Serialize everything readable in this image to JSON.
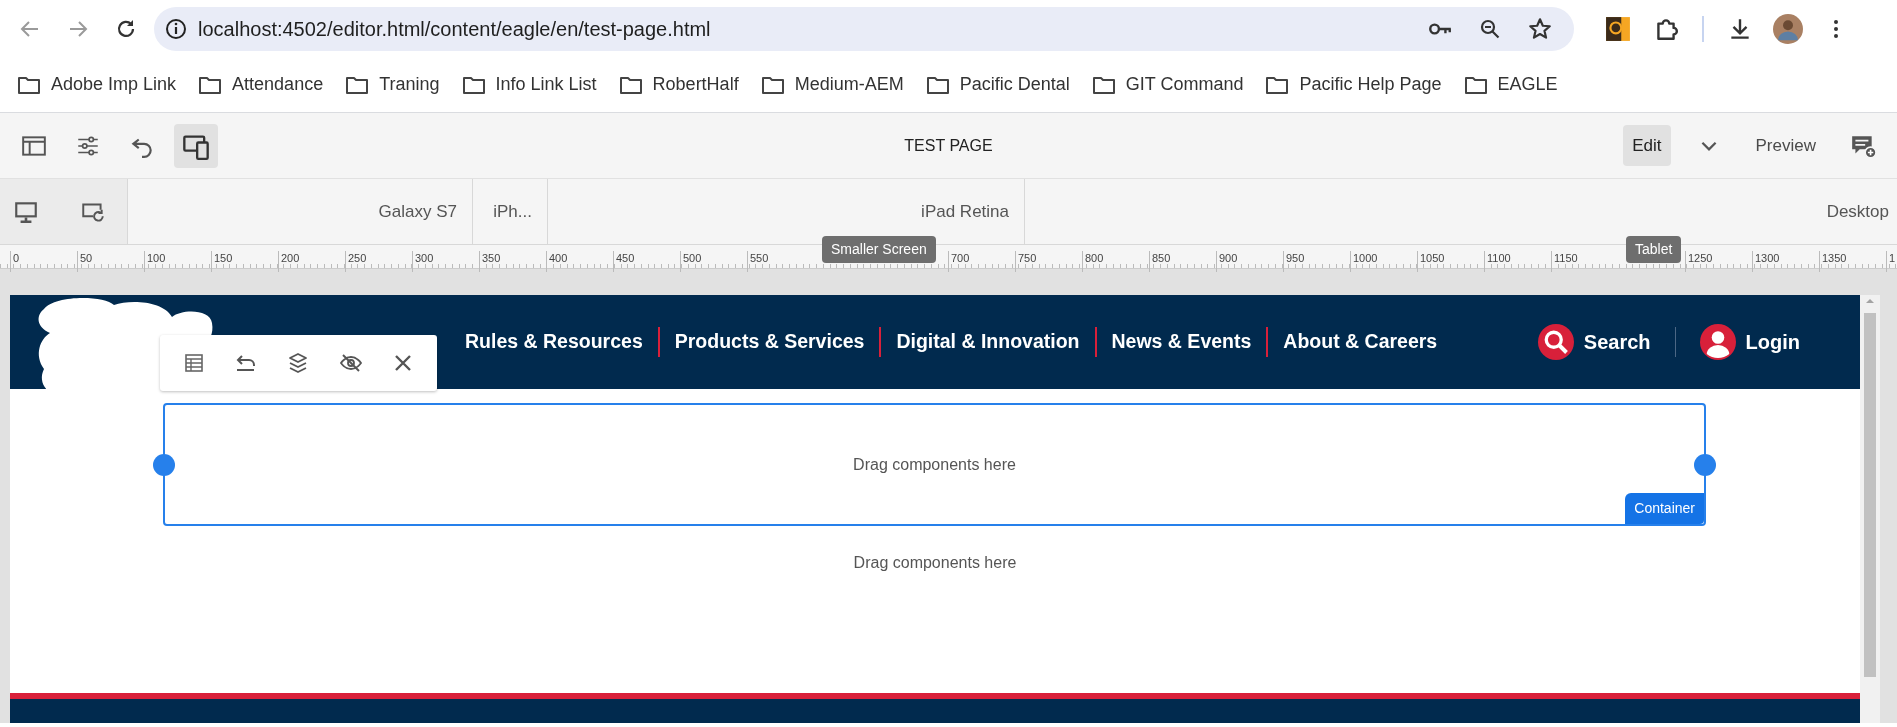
{
  "browser": {
    "url": "localhost:4502/editor.html/content/eagle/en/test-page.html",
    "bookmarks": [
      "Adobe Imp Link",
      "Attendance",
      "Traning",
      "Info Link List",
      "RobertHalf",
      "Medium-AEM",
      "Pacific Dental",
      "GIT Command",
      "Pacific Help Page",
      "EAGLE"
    ]
  },
  "editor_toolbar": {
    "title": "TEST PAGE",
    "emulator_on": true,
    "modes": [
      {
        "label": "Edit",
        "selected": true
      },
      {
        "label": "Preview",
        "selected": false
      }
    ]
  },
  "device_bar": {
    "devices": [
      "Galaxy S7",
      "iPh...",
      "iPad Retina",
      "Desktop"
    ]
  },
  "ruler": {
    "items": [
      {
        "kind": "tick",
        "label": "0"
      },
      {
        "kind": "tick",
        "label": "50"
      },
      {
        "kind": "tick",
        "label": "100"
      },
      {
        "kind": "tick",
        "label": "150"
      },
      {
        "kind": "tick",
        "label": "200"
      },
      {
        "kind": "tick",
        "label": "250"
      },
      {
        "kind": "tick",
        "label": "300"
      },
      {
        "kind": "tick",
        "label": "350"
      },
      {
        "kind": "tick",
        "label": "400"
      },
      {
        "kind": "tick",
        "label": "450"
      },
      {
        "kind": "tick",
        "label": "500"
      },
      {
        "kind": "tick",
        "label": "550"
      },
      {
        "kind": "tooltip",
        "label": "Smaller Screen"
      },
      {
        "kind": "tick",
        "label": "700"
      },
      {
        "kind": "tick",
        "label": "750"
      },
      {
        "kind": "tick",
        "label": "800"
      },
      {
        "kind": "tick",
        "label": "850"
      },
      {
        "kind": "tick",
        "label": "900"
      },
      {
        "kind": "tick",
        "label": "950"
      },
      {
        "kind": "tick",
        "label": "1000"
      },
      {
        "kind": "tick",
        "label": "1050"
      },
      {
        "kind": "tick",
        "label": "1100"
      },
      {
        "kind": "tick",
        "label": "1150"
      },
      {
        "kind": "tooltip",
        "label": "Tablet"
      },
      {
        "kind": "tick",
        "label": "1250"
      },
      {
        "kind": "tick",
        "label": "1300"
      },
      {
        "kind": "tick",
        "label": "1350"
      },
      {
        "kind": "tick",
        "label": "1"
      }
    ]
  },
  "site_header": {
    "nav": [
      "Rules & Resources",
      "Products & Services",
      "Digital & Innovation",
      "News & Events",
      "About & Careers"
    ],
    "search": "Search",
    "login": "Login"
  },
  "container": {
    "selected": true,
    "label": "Container",
    "hint": "Drag components here"
  },
  "drop_zone": {
    "hint": "Drag components here"
  }
}
